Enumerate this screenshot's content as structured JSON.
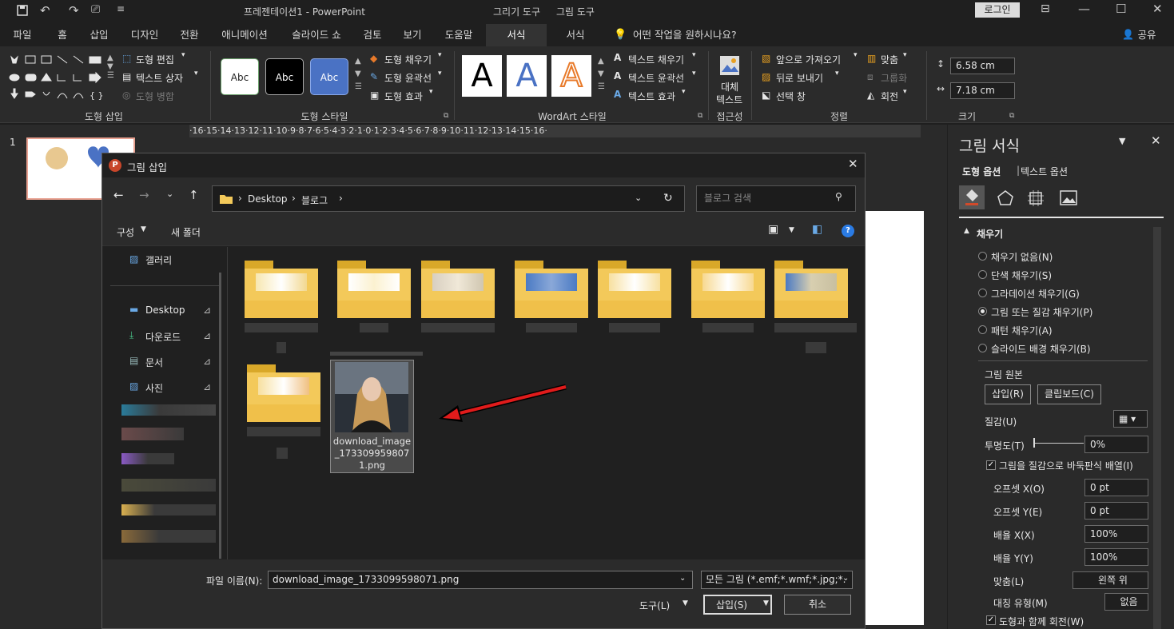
{
  "titlebar": {
    "doc_title": "프레젠테이션1 - PowerPoint",
    "context_tab1": "그리기 도구",
    "context_tab2": "그림 도구",
    "login": "로그인"
  },
  "tabs": [
    "파일",
    "홈",
    "삽입",
    "디자인",
    "전환",
    "애니메이션",
    "슬라이드 쇼",
    "검토",
    "보기",
    "도움말",
    "서식",
    "서식"
  ],
  "tell_me": "어떤 작업을 원하시나요?",
  "share": "공유",
  "ribbon": {
    "shape_insert": {
      "edit_shape": "도형 편집",
      "text_box": "텍스트 상자",
      "merge_shapes": "도형 병합",
      "label": "도형 삽입"
    },
    "shape_styles": {
      "sample": "Abc",
      "fill": "도형 채우기",
      "outline": "도형 윤곽선",
      "effects": "도형 효과",
      "label": "도형 스타일"
    },
    "wordart": {
      "letter": "A",
      "text_fill": "텍스트 채우기",
      "text_outline": "텍스트 윤곽선",
      "text_effects": "텍스트 효과",
      "label": "WordArt 스타일"
    },
    "accessibility": {
      "alt_text_1": "대체",
      "alt_text_2": "텍스트",
      "label": "접근성"
    },
    "arrange": {
      "bring_forward": "앞으로 가져오기",
      "send_backward": "뒤로 보내기",
      "selection_pane": "선택 창",
      "align": "맞춤",
      "group": "그룹화",
      "rotate": "회전",
      "label": "정렬"
    },
    "size": {
      "height": "6.58 cm",
      "width": "7.18 cm",
      "label": "크기"
    }
  },
  "ruler": "·16·15·14·13·12·11·10·9·8·7·6·5·4·3·2·1·0·1·2·3·4·5·6·7·8·9·10·11·12·13·14·15·16·",
  "slide_number": "1",
  "dialog": {
    "title": "그림 삽입",
    "path": [
      "Desktop",
      "블로그"
    ],
    "search_placeholder": "블로그 검색",
    "organize": "구성",
    "new_folder": "새 폴더",
    "nav": {
      "gallery": "갤러리",
      "desktop": "Desktop",
      "downloads": "다운로드",
      "documents": "문서",
      "pictures": "사진"
    },
    "selected_file": {
      "line1": "download_image",
      "line2": "_173309959807",
      "line3": "1.png"
    },
    "filename_label": "파일 이름(N):",
    "filename_value": "download_image_1733099598071.png",
    "filter": "모든 그림 (*.emf;*.wmf;*.jpg;*.",
    "tools": "도구(L)",
    "insert": "삽입(S)",
    "cancel": "취소"
  },
  "pane": {
    "title": "그림 서식",
    "tab_shape": "도형 옵션",
    "tab_text": "텍스트 옵션",
    "section_fill": "채우기",
    "fill_options": [
      "채우기 없음(N)",
      "단색 채우기(S)",
      "그라데이션 채우기(G)",
      "그림 또는 질감 채우기(P)",
      "패턴 채우기(A)",
      "슬라이드 배경 채우기(B)"
    ],
    "fill_selected_index": 3,
    "picture_source": "그림 원본",
    "insert_btn": "삽입(R)",
    "clipboard_btn": "클립보드(C)",
    "texture": "질감(U)",
    "transparency": "투명도(T)",
    "transparency_value": "0%",
    "tile": "그림을 질감으로 바둑판식 배열(I)",
    "offset_x": "오프셋 X(O)",
    "offset_x_value": "0 pt",
    "offset_y": "오프셋 Y(E)",
    "offset_y_value": "0 pt",
    "scale_x": "배율 X(X)",
    "scale_x_value": "100%",
    "scale_y": "배율 Y(Y)",
    "scale_y_value": "100%",
    "alignment": "맞춤(L)",
    "alignment_value": "왼쪽 위",
    "mirror": "대칭 유형(M)",
    "mirror_value": "없음",
    "rotate_with_shape": "도형과 함께 회전(W)"
  },
  "colors": {
    "accent": "#b7472a",
    "folder": "#f3c95a",
    "arrow": "#e01b1b"
  }
}
